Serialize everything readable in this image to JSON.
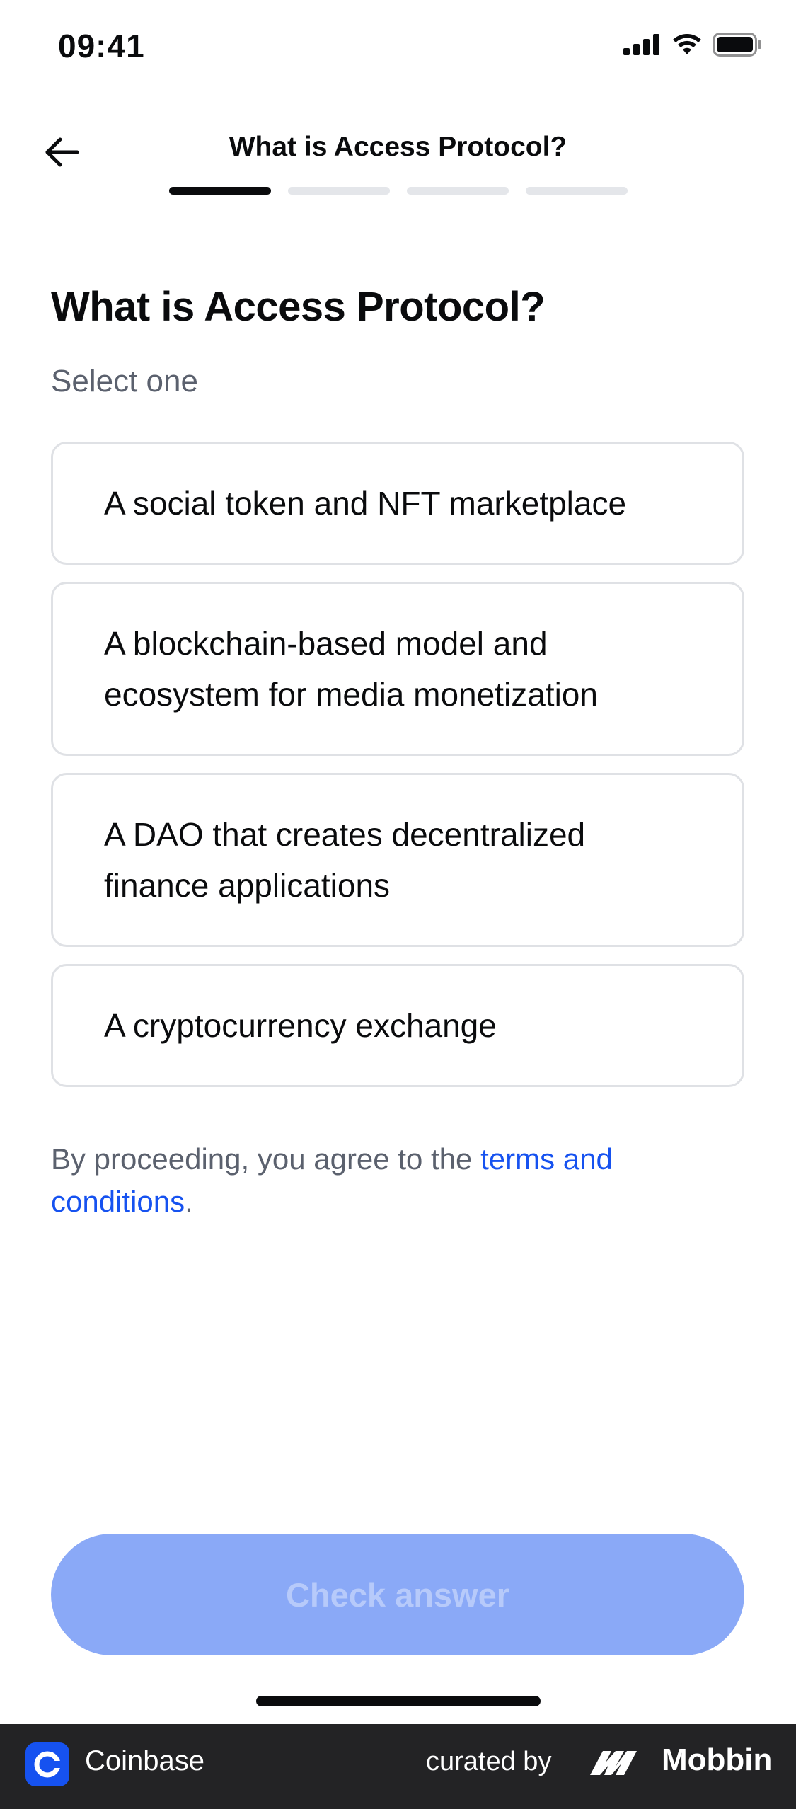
{
  "status_bar": {
    "time": "09:41"
  },
  "header": {
    "title": "What is Access Protocol?",
    "progress": {
      "current_step": 1,
      "total_steps": 4
    }
  },
  "question": {
    "title": "What is Access Protocol?",
    "subtitle": "Select one",
    "options": [
      "A social token and NFT marketplace",
      "A blockchain-based model and ecosystem for media monetization",
      "A DAO that creates decentralized finance applications",
      "A cryptocurrency exchange"
    ]
  },
  "terms": {
    "prefix": "By proceeding, you agree to the ",
    "link": "terms and conditions",
    "suffix": "."
  },
  "cta": {
    "label": "Check answer",
    "enabled": false
  },
  "footer": {
    "app_name": "Coinbase",
    "curated_by": "curated by",
    "brand": "Mobbin"
  },
  "colors": {
    "accent": "#1652f0",
    "cta_disabled_bg": "#8aa9f7",
    "text_primary": "#0a0b0d",
    "text_secondary": "#5b616e",
    "footer_bg": "#232325"
  }
}
